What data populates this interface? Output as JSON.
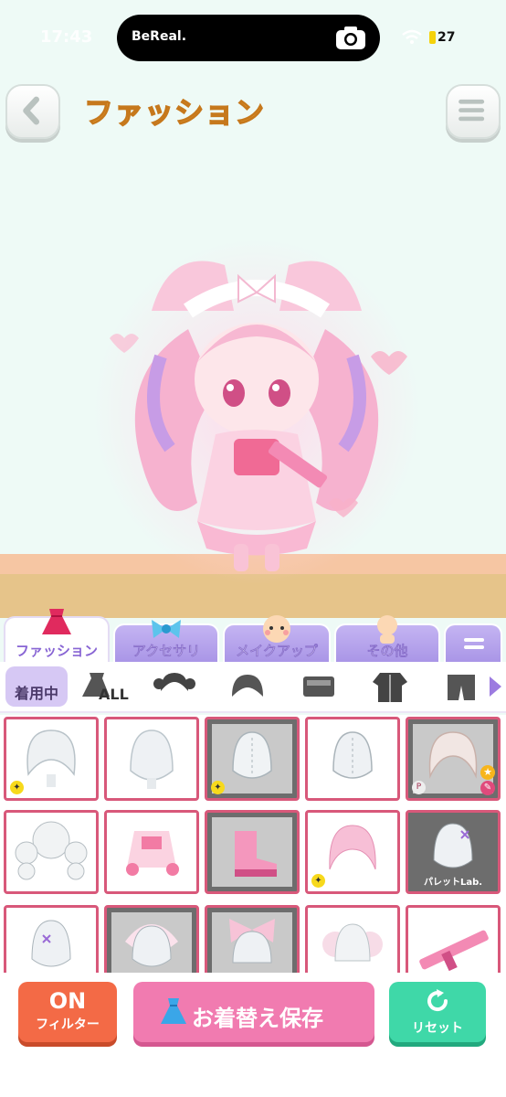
{
  "status_bar": {
    "time": "17:43",
    "battery": "27"
  },
  "notification": {
    "app_name": "BeReal."
  },
  "header": {
    "title": "ファッション"
  },
  "tabs": [
    {
      "label": "ファッション",
      "active": true
    },
    {
      "label": "アクセサリ",
      "active": false
    },
    {
      "label": "メイクアップ",
      "active": false
    },
    {
      "label": "その他",
      "active": false
    }
  ],
  "filter_row": {
    "wearing_label": "着用中",
    "all_label": "ALL"
  },
  "grid": {
    "tags": {
      "palette": "パレットLab."
    }
  },
  "bottom": {
    "filter_top": "ON",
    "filter_bottom": "フィルター",
    "save_label": "お着替え保存",
    "reset_label": "リセット"
  },
  "colors": {
    "background": "#eefaf6",
    "tab_active_text": "#8865d4",
    "cell_border": "#d8587a",
    "filter_button": "#f36a46",
    "save_button": "#f17bb0",
    "reset_button": "#3fd8a8"
  }
}
